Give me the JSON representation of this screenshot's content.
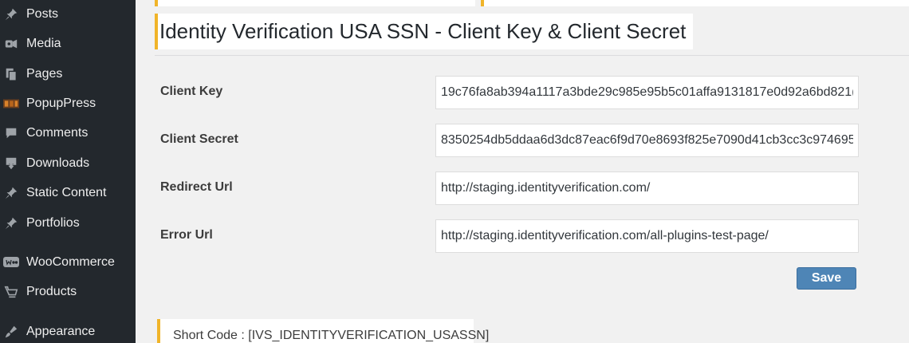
{
  "sidebar": {
    "items": [
      {
        "label": "Posts",
        "icon": "pin-icon"
      },
      {
        "label": "Media",
        "icon": "media-icon"
      },
      {
        "label": "Pages",
        "icon": "pages-icon"
      },
      {
        "label": "PopupPress",
        "icon": "popuppress-icon"
      },
      {
        "label": "Comments",
        "icon": "comments-icon"
      },
      {
        "label": "Downloads",
        "icon": "download-icon"
      },
      {
        "label": "Static Content",
        "icon": "pin-icon"
      },
      {
        "label": "Portfolios",
        "icon": "pin-icon"
      },
      {
        "label": "WooCommerce",
        "icon": "woocommerce-icon"
      },
      {
        "label": "Products",
        "icon": "products-icon"
      },
      {
        "label": "Appearance",
        "icon": "appearance-icon"
      }
    ]
  },
  "page": {
    "title": "Identity Verification USA SSN - Client Key & Client Secret"
  },
  "form": {
    "client_key": {
      "label": "Client Key",
      "value": "19c76fa8ab394a1117a3bde29c985e95b5c01affa9131817e0d92a6bd821(",
      "name": "client_key"
    },
    "client_secret": {
      "label": "Client Secret",
      "value": "8350254db5ddaa6d3dc87eac6f9d70e8693f825e7090d41cb3cc3c974695(",
      "name": "client_secret"
    },
    "redirect_url": {
      "label": "Redirect Url",
      "value": "http://staging.identityverification.com/",
      "name": "redirect_url"
    },
    "error_url": {
      "label": "Error Url",
      "value": "http://staging.identityverification.com/all-plugins-test-page/",
      "name": "error_url"
    },
    "save_label": "Save"
  },
  "shortcode": {
    "text": "Short Code : [IVS_IDENTITYVERIFICATION_USASSN]"
  },
  "colors": {
    "sidebar_bg": "#23282d",
    "accent_border": "#f0b429",
    "button": "#4e85b6"
  }
}
